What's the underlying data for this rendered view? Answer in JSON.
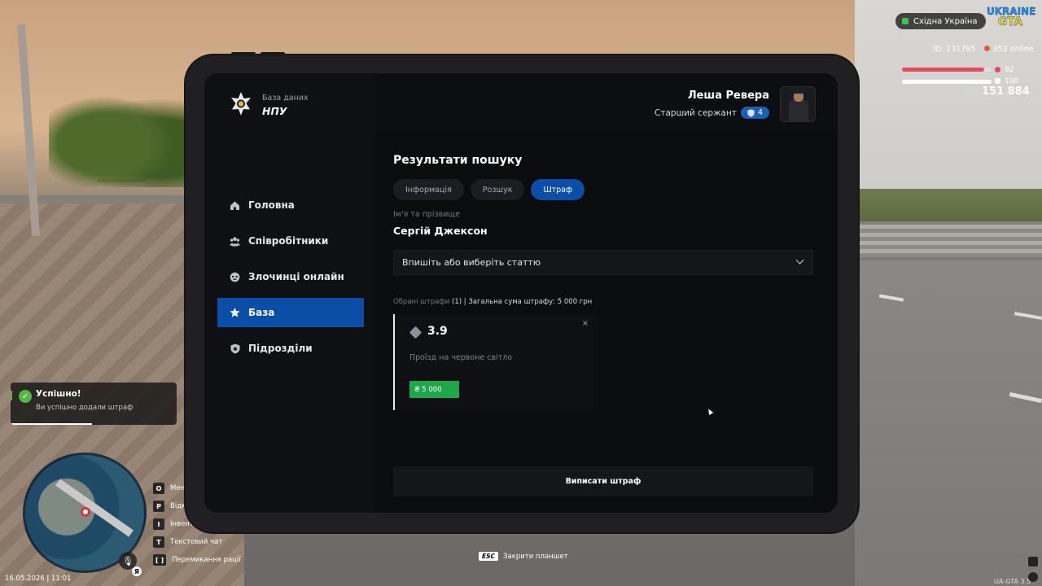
{
  "hud": {
    "region": "Східна Україна",
    "logo_line1": "UKRAINE",
    "logo_line2": "GTA",
    "player_id": "ID: 131795",
    "online": "352 online",
    "health": "92",
    "armor": "100",
    "health_level": 0.92,
    "armor_level": 1.0,
    "money": "151 884",
    "health_color": "#e14b5a",
    "armor_color": "#ffffff"
  },
  "toast": {
    "title": "Успішно!",
    "message": "Ви успішно додали штраф",
    "accent": "#53b63f"
  },
  "keybinds": [
    {
      "key": "O",
      "label": "Мен"
    },
    {
      "key": "P",
      "label": "Відк"
    },
    {
      "key": "I",
      "label": "Інвент"
    },
    {
      "key": "T",
      "label": "Текстовий чат"
    },
    {
      "key": "[ ]",
      "label": "Перемикання рації"
    }
  ],
  "voice": {
    "lang": "Я"
  },
  "datetime": "16.05.2026 | 11:01",
  "esc_hint": {
    "key": "ESC",
    "label": "Закрити планшет"
  },
  "version": "UA-GTA 3.5",
  "tablet": {
    "brand_sub": "База даних",
    "brand_title": "НПУ",
    "nav": [
      {
        "label": "Головна",
        "icon": "home-icon"
      },
      {
        "label": "Співробітники",
        "icon": "people-icon"
      },
      {
        "label": "Злочинці онлайн",
        "icon": "mask-icon"
      },
      {
        "label": "База",
        "icon": "star-icon",
        "active": true
      },
      {
        "label": "Підрозділи",
        "icon": "shield-icon"
      }
    ],
    "user": {
      "name": "Леша Ревера",
      "rank": "Старший сержант",
      "rank_level": "4"
    },
    "results_title": "Результати пошуку",
    "tabs": [
      "Інформація",
      "Розшук",
      "Штраф"
    ],
    "active_tab": "Штраф",
    "field_label": "Ім'я та прізвище",
    "field_value": "Сергій Джексон",
    "article_select_placeholder": "Впишіть або виберіть статтю",
    "summary": {
      "prefix": "Обрані штрафи",
      "count": "(1)",
      "total": "| Загальна сума штрафу: 5 000 грн"
    },
    "fine": {
      "article": "3.9",
      "description": "Проїзд на червоне світло",
      "amount": "₴ 5 000",
      "close": "×"
    },
    "issue_button": "Виписати штраф",
    "accent_color": "#0a4ea8",
    "money_color": "#1fa84b"
  }
}
